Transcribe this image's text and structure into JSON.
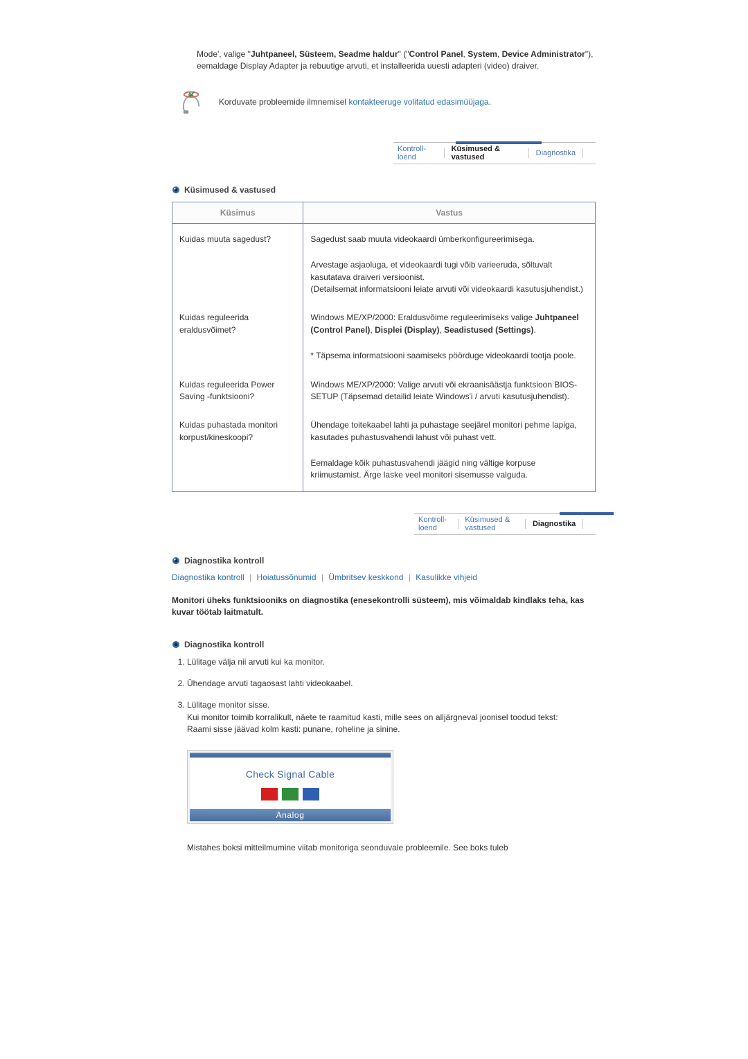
{
  "intro": {
    "pre": "Mode', valige \"",
    "bold1": "Juhtpaneel, Süsteem, Seadme haldur",
    "mid1": "\" (\"",
    "bold2": "Control Panel",
    "mid2": ", ",
    "bold3": "System",
    "mid3": ", ",
    "bold4": "Device Administrator",
    "tail": "\"), eemaldage Display Adapter ja rebuutige arvuti, et installeerida uuesti adapteri (video) draiver."
  },
  "contact": {
    "pre": "Korduvate probleemide ilmnemisel ",
    "link": "kontakteeruge volitatud edasimüüjaga",
    "post": "."
  },
  "tabs": {
    "items": [
      "Kontroll-loend",
      "Küsimused & vastused",
      "Diagnostika"
    ],
    "active_qna": 1,
    "active_diag": 2
  },
  "section_qna_title": "Küsimused & vastused",
  "qa": {
    "head_q": "Küsimus",
    "head_a": "Vastus",
    "rows": [
      {
        "q": "Kuidas muuta sagedust?",
        "a_blocks": [
          "Sagedust saab muuta videokaardi ümberkonfigureerimisega.",
          "Arvestage asjaoluga, et videokaardi tugi võib varieeruda, sõltuvalt kasutatava draiveri versioonist.\n(Detailsemat informatsiooni leiate arvuti või videokaardi kasutusjuhendist.)"
        ]
      },
      {
        "q": "Kuidas reguleerida eraldusvõimet?",
        "a_html": "Windows ME/XP/2000: Eraldusvõime reguleerimiseks valige <b>Juhtpaneel (Control Panel)</b>, <b>Displei (Display)</b>, <b>Seadistused (Settings)</b>.",
        "a_blocks_after": [
          "* Täpsema informatsiooni saamiseks pöörduge videokaardi tootja poole."
        ]
      },
      {
        "q": "Kuidas reguleerida Power Saving -funktsiooni?",
        "a_blocks": [
          "Windows ME/XP/2000: Valige arvuti või ekraanisäästja funktsioon BIOS-SETUP (Täpsemad detailid leiate Windows'i / arvuti kasutusjuhendist)."
        ]
      },
      {
        "q": "Kuidas puhastada monitori korpust/kineskoopi?",
        "a_blocks": [
          "Ühendage toitekaabel lahti ja puhastage seejärel monitori pehme lapiga, kasutades puhastusvahendi lahust või puhast vett.",
          "Eemaldage kõik puhastusvahendi jäägid ning vältige korpuse kriimustamist. Ärge laske veel monitori sisemusse valguda."
        ]
      }
    ]
  },
  "section_diag_title": "Diagnostika kontroll",
  "sublinks": [
    "Diagnostika kontroll",
    "Hoiatussõnumid",
    "Ümbritsev keskkond",
    "Kasulikke vihjeid"
  ],
  "diag_strong": "Monitori üheks funktsiooniks on diagnostika (enesekontrolli süsteem), mis võimaldab kindlaks teha, kas kuvar töötab laitmatult.",
  "diag_heading2": "Diagnostika kontroll",
  "steps": [
    "Lülitage välja nii arvuti kui ka monitor.",
    "Ühendage arvuti tagaosast lahti videokaabel.",
    "Lülitage monitor sisse.\nKui monitor toimib korralikult, näete te raamitud kasti, mille sees on alljärgneval joonisel toodud tekst:\nRaami sisse jäävad kolm kasti: punane, roheline ja sinine."
  ],
  "signal_box": {
    "message": "Check Signal Cable",
    "footer": "Analog"
  },
  "tail": "Mistahes boksi mitteilmumine viitab monitoriga seonduvale probleemile. See boks tuleb"
}
